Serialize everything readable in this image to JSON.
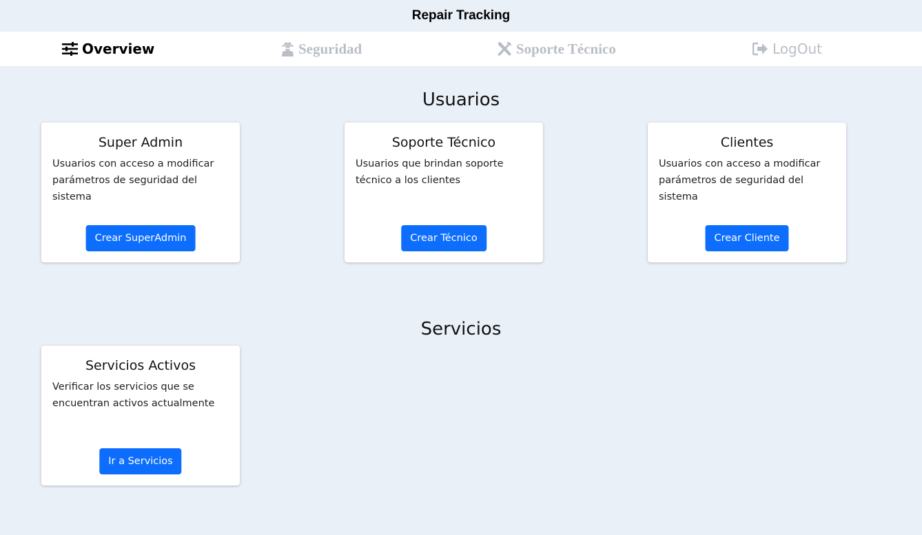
{
  "app": {
    "title": "Repair Tracking"
  },
  "nav": {
    "overview": "Overview",
    "seguridad": "Seguridad",
    "soporte": "Soporte Técnico",
    "logout": "LogOut"
  },
  "colors": {
    "accent": "#0d6efd",
    "background": "#eaf0f8",
    "nav_inactive": "#b9bec6"
  },
  "usuarios": {
    "title": "Usuarios",
    "cards": [
      {
        "title": "Super Admin",
        "text": "Usuarios con acceso a modificar parámetros de seguridad del sistema",
        "button": "Crear SuperAdmin"
      },
      {
        "title": "Soporte Técnico",
        "text": "Usuarios que brindan soporte técnico a los clientes",
        "button": "Crear Técnico"
      },
      {
        "title": "Clientes",
        "text": "Usuarios con acceso a modificar parámetros de seguridad del sistema",
        "button": "Crear Cliente"
      }
    ]
  },
  "servicios": {
    "title": "Servicios",
    "cards": [
      {
        "title": "Servicios Activos",
        "text": "Verificar los servicios que se encuentran activos actualmente",
        "button": "Ir a Servicios"
      }
    ]
  },
  "icons": {
    "overview": "sliders-icon",
    "seguridad": "user-secret-icon",
    "soporte": "tools-icon",
    "logout": "sign-out-icon"
  }
}
